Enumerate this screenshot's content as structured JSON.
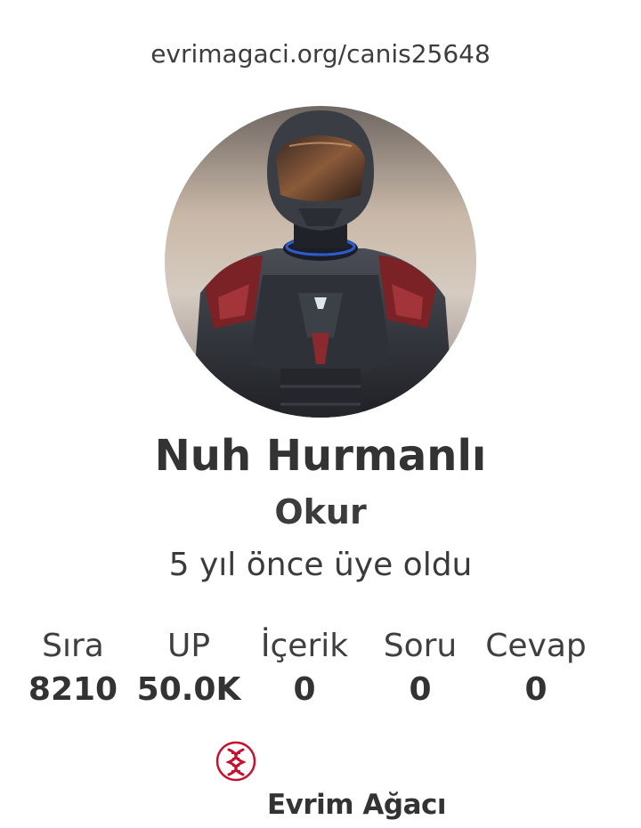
{
  "profile": {
    "url": "evrimagaci.org/canis25648",
    "name": "Nuh Hurmanlı",
    "role": "Okur",
    "joined": "5 yıl önce üye oldu"
  },
  "stats": [
    {
      "label": "Sıra",
      "value": "8210"
    },
    {
      "label": "UP",
      "value": "50.0K"
    },
    {
      "label": "İçerik",
      "value": "0"
    },
    {
      "label": "Soru",
      "value": "0"
    },
    {
      "label": "Cevap",
      "value": "0"
    }
  ],
  "footer": {
    "brand": "Evrim Ağacı",
    "logo_icon": "dna-icon",
    "logo_color": "#c8102e"
  }
}
